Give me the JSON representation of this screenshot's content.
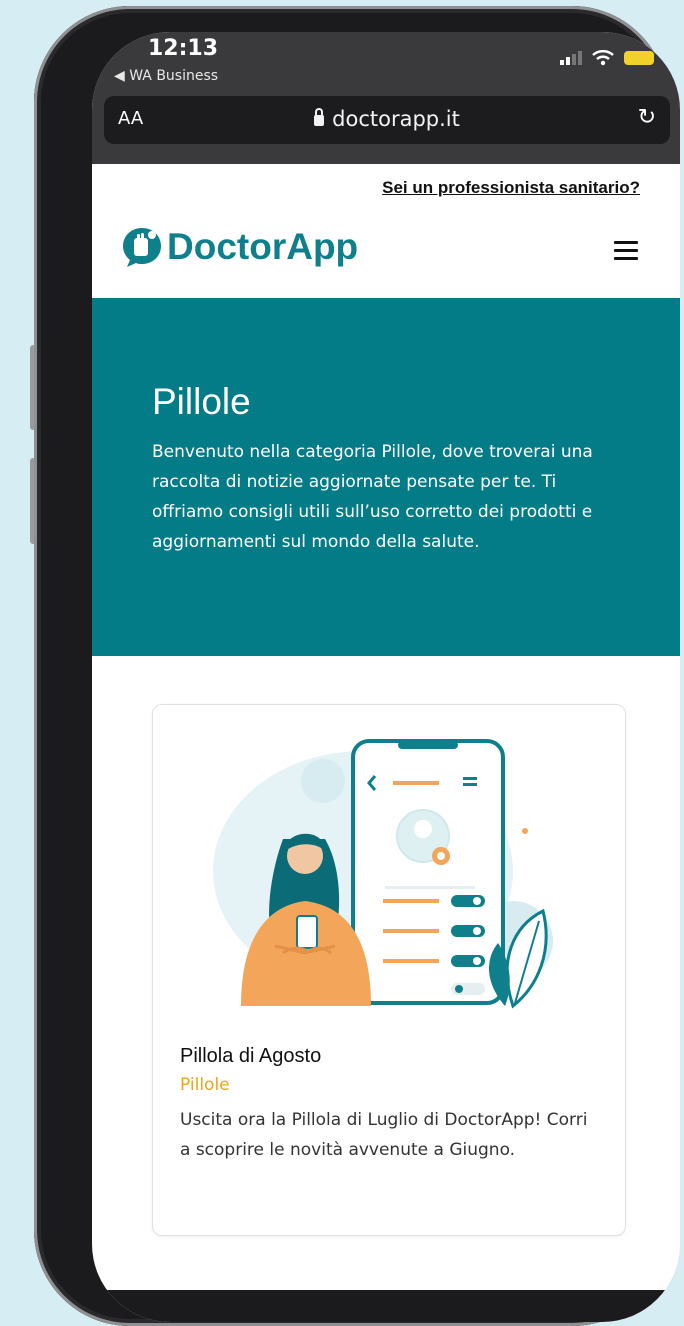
{
  "status_bar": {
    "time": "12:13",
    "back_label": "◀ WA Business"
  },
  "browser": {
    "text_size_label": "AA",
    "url": "doctorapp.it"
  },
  "header": {
    "professional_link": "Sei un professionista sanitario?",
    "logo_text": "DoctorApp"
  },
  "hero": {
    "title": "Pillole",
    "description": "Benvenuto nella categoria Pillole, dove troverai una raccolta di notizie aggiornate pensate per te. Ti offriamo consigli utili sull’uso corretto dei prodotti e aggiornamenti sul mondo della salute."
  },
  "card": {
    "title": "Pillola di Agosto",
    "category": "Pillole",
    "excerpt": "Uscita ora la Pillola di Luglio di DoctorApp! Corri a scoprire le novità avvenute a Giugno."
  },
  "colors": {
    "brand_teal": "#047c88",
    "category_gold": "#e8a61a",
    "illustration_orange": "#f3a65a"
  }
}
